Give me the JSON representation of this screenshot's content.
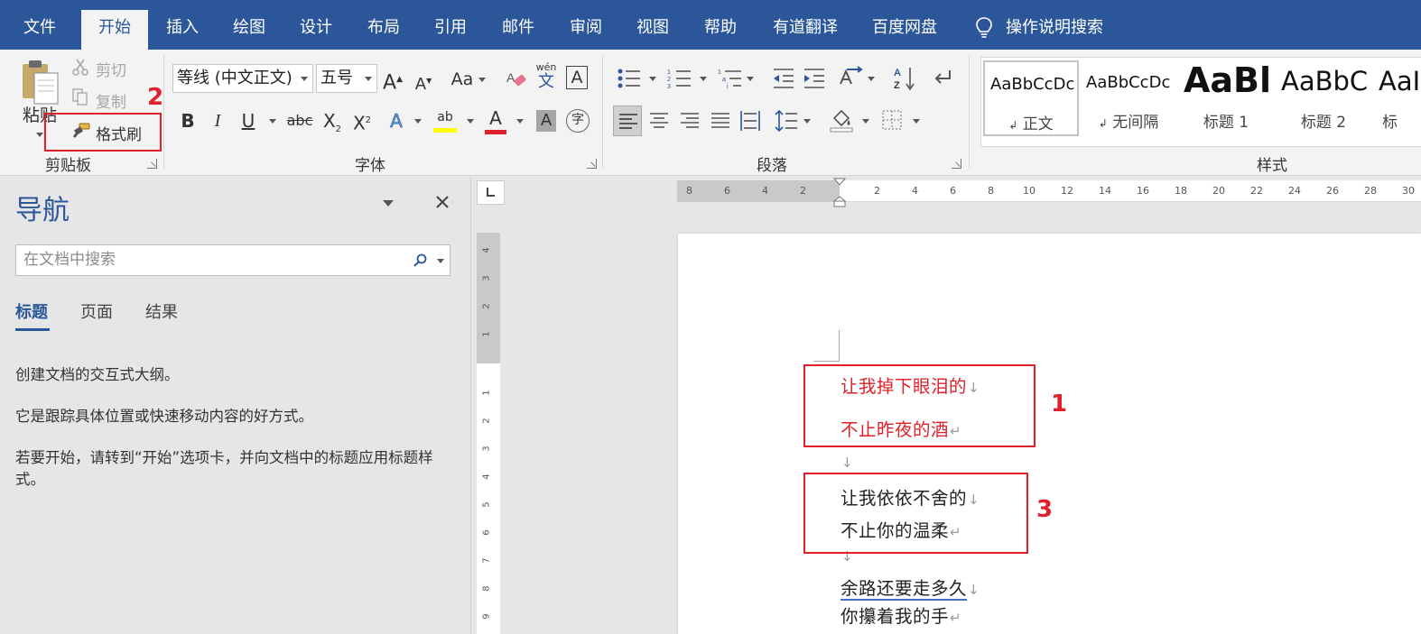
{
  "tabs": [
    {
      "label": "文件"
    },
    {
      "label": "开始"
    },
    {
      "label": "插入"
    },
    {
      "label": "绘图"
    },
    {
      "label": "设计"
    },
    {
      "label": "布局"
    },
    {
      "label": "引用"
    },
    {
      "label": "邮件"
    },
    {
      "label": "审阅"
    },
    {
      "label": "视图"
    },
    {
      "label": "帮助"
    },
    {
      "label": "有道翻译"
    },
    {
      "label": "百度网盘"
    }
  ],
  "active_tab": "开始",
  "tell_me": "操作说明搜索",
  "clipboard": {
    "paste": "粘贴",
    "cut": "剪切",
    "copy": "复制",
    "format_painter": "格式刷",
    "group_label": "剪贴板"
  },
  "font": {
    "name": "等线 (中文正文)",
    "size": "五号",
    "group_label": "字体",
    "bold": "B",
    "italic": "I",
    "underline": "U",
    "strike": "abc",
    "subscript": "X",
    "superscript": "X",
    "grow": "A",
    "shrink": "A",
    "case": "Aa",
    "phonetic_top": "wén",
    "phonetic_bottom": "文",
    "border_char": "A",
    "effects": "A",
    "highlight": "ab",
    "font_color": "A",
    "shading": "A",
    "enclose": "字"
  },
  "paragraph": {
    "group_label": "段落"
  },
  "styles": {
    "group_label": "样式",
    "items": [
      {
        "sample": "AaBbCcDc",
        "name": "正文",
        "mark": "↲"
      },
      {
        "sample": "AaBbCcDc",
        "name": "无间隔",
        "mark": "↲"
      },
      {
        "sample": "AaBl",
        "name": "标题 1"
      },
      {
        "sample": "AaBbC",
        "name": "标题 2"
      },
      {
        "sample": "AaI",
        "name": "标"
      }
    ]
  },
  "annotations": {
    "n1": "1",
    "n2": "2",
    "n3": "3"
  },
  "nav": {
    "title": "导航",
    "search_placeholder": "在文档中搜索",
    "tabs": [
      {
        "label": "标题"
      },
      {
        "label": "页面"
      },
      {
        "label": "结果"
      }
    ],
    "text1": "创建文档的交互式大纲。",
    "text2": "它是跟踪具体位置或快速移动内容的好方式。",
    "text3": "若要开始，请转到“开始”选项卡，并向文档中的标题应用标题样式。"
  },
  "ruler": {
    "h_left": [
      "8",
      "6",
      "4",
      "2"
    ],
    "h_right": [
      "2",
      "4",
      "6",
      "8",
      "10",
      "12",
      "14",
      "16",
      "18",
      "20",
      "22",
      "24",
      "26",
      "28",
      "30"
    ],
    "v_top": [
      "4",
      "3",
      "2",
      "1"
    ],
    "v_bottom": [
      "1",
      "2",
      "3",
      "4",
      "5",
      "6",
      "7",
      "8",
      "9"
    ]
  },
  "document": {
    "lines": [
      {
        "text": "让我掉下眼泪的",
        "mark": "↓"
      },
      {
        "text": "不止昨夜的酒",
        "mark": "↵"
      },
      {
        "text": "",
        "mark": "↓"
      },
      {
        "text": "让我依依不舍的",
        "mark": "↓"
      },
      {
        "text": "不止你的温柔",
        "mark": "↵"
      },
      {
        "text": "",
        "mark": "↓"
      },
      {
        "text": "余路还要走多久",
        "mark": "↓"
      },
      {
        "text": "你攥着我的手",
        "mark": "↵"
      }
    ]
  },
  "colors": {
    "accent": "#2b579a",
    "annotation_red": "#e0202a"
  }
}
